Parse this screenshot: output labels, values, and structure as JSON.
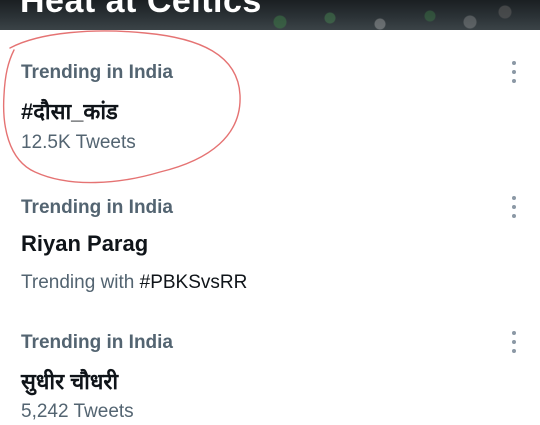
{
  "banner": {
    "title": "Heat at Celtics"
  },
  "trends": [
    {
      "context": "Trending in India",
      "title": "#दौसा_कांड",
      "meta": "12.5K Tweets"
    },
    {
      "context": "Trending in India",
      "title": "Riyan Parag",
      "meta_prefix": "Trending with ",
      "meta_tag": "#PBKSvsRR"
    },
    {
      "context": "Trending in India",
      "title": "सुधीर चौधरी",
      "meta": "5,242 Tweets"
    }
  ],
  "icons": {
    "more": "more-vertical-icon"
  },
  "colors": {
    "annotation_circle": "#e57373",
    "secondary_text": "#536471",
    "primary_text": "#0f1419"
  }
}
